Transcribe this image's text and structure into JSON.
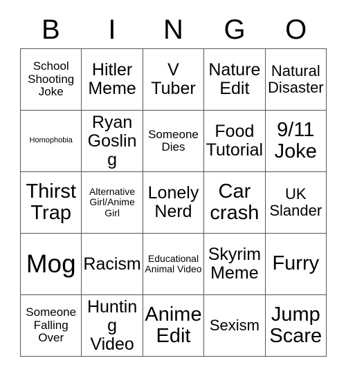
{
  "card": {
    "header_letters": [
      "B",
      "I",
      "N",
      "G",
      "O"
    ],
    "columns": 5,
    "rows": 5,
    "border_color": "#555555",
    "background_color": "#ffffff",
    "text_color": "#000000",
    "cells": [
      [
        {
          "text": "School Shooting Joke",
          "size": "sm"
        },
        {
          "text": "Hitler Meme",
          "size": "lg"
        },
        {
          "text": "V Tuber",
          "size": "lg"
        },
        {
          "text": "Nature Edit",
          "size": "lg"
        },
        {
          "text": "Natural Disaster",
          "size": "md"
        }
      ],
      [
        {
          "text": "Homophobia",
          "size": "xxs"
        },
        {
          "text": "Ryan Gosling",
          "size": "lg"
        },
        {
          "text": "Someone Dies",
          "size": "sm"
        },
        {
          "text": "Food Tutorial",
          "size": "lg"
        },
        {
          "text": "9/11 Joke",
          "size": "xl"
        }
      ],
      [
        {
          "text": "Thirst Trap",
          "size": "xl"
        },
        {
          "text": "Alternative Girl/Anime Girl",
          "size": "xs"
        },
        {
          "text": "Lonely Nerd",
          "size": "lg"
        },
        {
          "text": "Car crash",
          "size": "xl"
        },
        {
          "text": "UK Slander",
          "size": "md"
        }
      ],
      [
        {
          "text": "Mog",
          "size": "xxl"
        },
        {
          "text": "Racism",
          "size": "lg"
        },
        {
          "text": "Educational Animal Video",
          "size": "xs"
        },
        {
          "text": "Skyrim Meme",
          "size": "lg"
        },
        {
          "text": "Furry",
          "size": "xl"
        }
      ],
      [
        {
          "text": "Someone Falling Over",
          "size": "sm"
        },
        {
          "text": "Hunting Video",
          "size": "lg"
        },
        {
          "text": "Anime Edit",
          "size": "xl"
        },
        {
          "text": "Sexism",
          "size": "md"
        },
        {
          "text": "Jump Scare",
          "size": "xl"
        }
      ]
    ]
  }
}
